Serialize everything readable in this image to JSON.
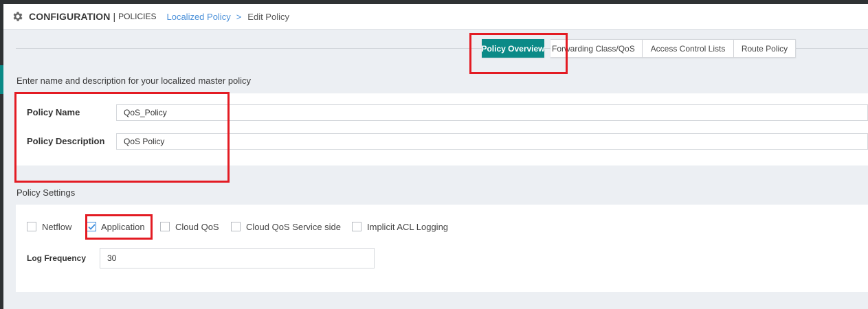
{
  "header": {
    "title": "CONFIGURATION",
    "separator": "|",
    "subtitle": "POLICIES",
    "breadcrumb_link": "Localized Policy",
    "breadcrumb_arrow": ">",
    "breadcrumb_current": "Edit Policy"
  },
  "tabs": [
    {
      "label": "Policy Overview",
      "active": true
    },
    {
      "label": "Forwarding Class/QoS",
      "active": false
    },
    {
      "label": "Access Control Lists",
      "active": false
    },
    {
      "label": "Route Policy",
      "active": false
    }
  ],
  "overview": {
    "section_title": "Enter name and description for your localized master policy",
    "policy_name_label": "Policy Name",
    "policy_name_value": "QoS_Policy",
    "policy_description_label": "Policy Description",
    "policy_description_value": "QoS Policy"
  },
  "settings": {
    "section_title": "Policy Settings",
    "checkboxes": [
      {
        "label": "Netflow",
        "checked": false
      },
      {
        "label": "Application",
        "checked": true
      },
      {
        "label": "Cloud QoS",
        "checked": false
      },
      {
        "label": "Cloud QoS Service side",
        "checked": false
      },
      {
        "label": "Implicit ACL Logging",
        "checked": false
      }
    ],
    "log_frequency_label": "Log Frequency",
    "log_frequency_value": "30"
  },
  "icons": {
    "header": "gear-icon",
    "checkmark": "check-icon"
  },
  "colors": {
    "accent": "#0b8a87",
    "link": "#4a90d9",
    "highlight": "#e31b23",
    "checkbox_checked": "#3e8ddd"
  }
}
